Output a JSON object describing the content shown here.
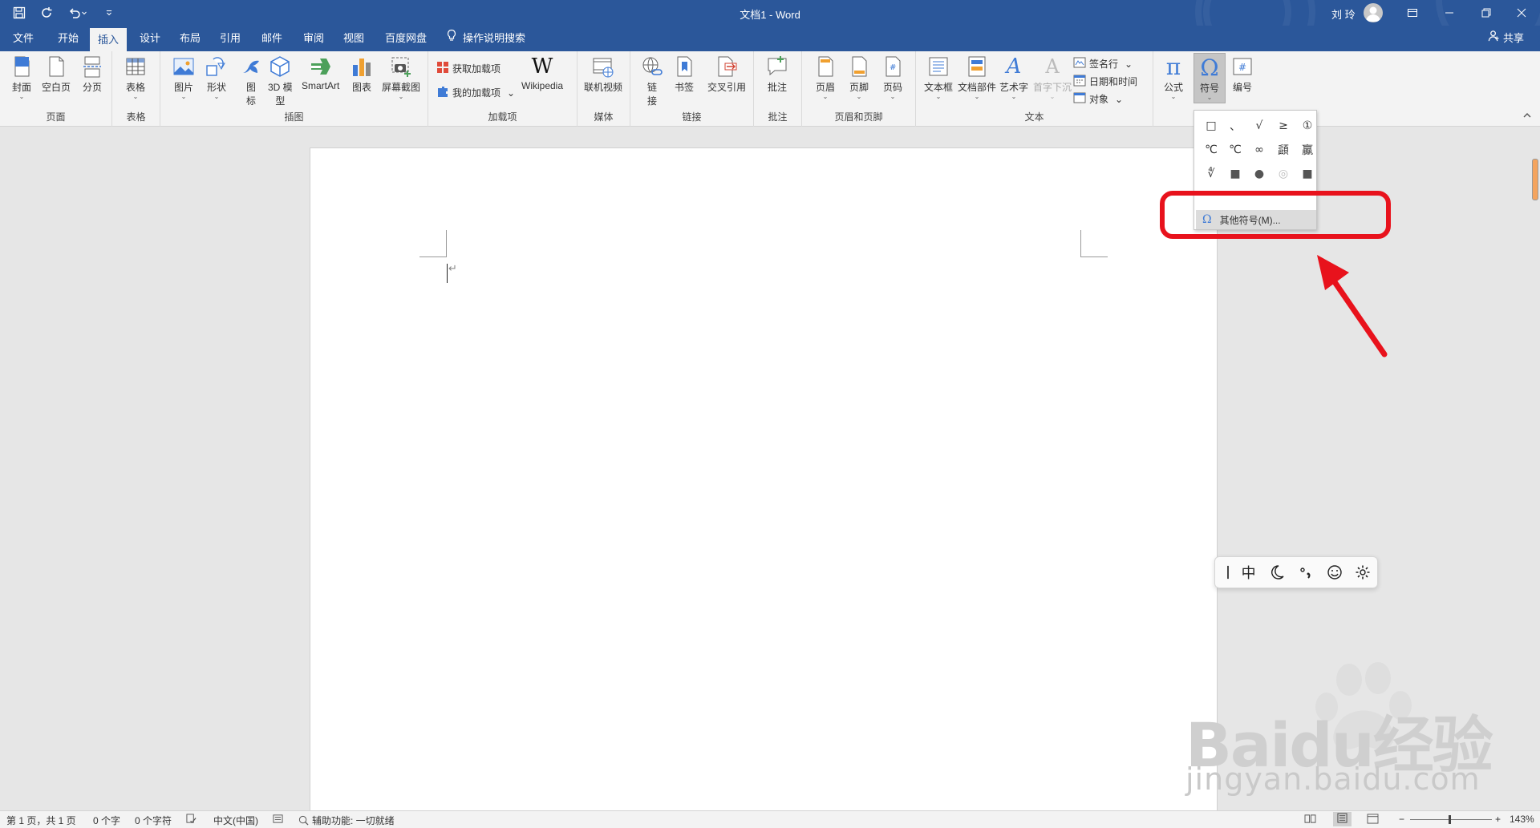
{
  "window": {
    "doc_title": "文档1 - Word",
    "user_name": "刘 玲"
  },
  "tabs": [
    {
      "label": "文件"
    },
    {
      "label": "开始"
    },
    {
      "label": "插入",
      "active": true
    },
    {
      "label": "设计"
    },
    {
      "label": "布局"
    },
    {
      "label": "引用"
    },
    {
      "label": "邮件"
    },
    {
      "label": "审阅"
    },
    {
      "label": "视图"
    },
    {
      "label": "百度网盘"
    }
  ],
  "tell_me": "操作说明搜索",
  "share": "共享",
  "ribbon": {
    "groups": {
      "pages": "页面",
      "tables": "表格",
      "illustrations": "插图",
      "addins": "加载项",
      "media": "媒体",
      "links": "链接",
      "comments": "批注",
      "header_footer": "页眉和页脚",
      "text": "文本"
    },
    "buttons": {
      "cover": "封面",
      "blank_page": "空白页",
      "page_break": "分页",
      "table": "表格",
      "picture": "图片",
      "shapes": "形状",
      "icons_line1": "图",
      "icons_line2": "标",
      "model3d_line1": "3D 模",
      "model3d_line2": "型",
      "smartart": "SmartArt",
      "chart": "图表",
      "screenshot": "屏幕截图",
      "get_addins": "获取加载项",
      "my_addins": "我的加载项",
      "wikipedia": "Wikipedia",
      "online_video": "联机视频",
      "link_line1": "链",
      "link_line2": "接",
      "bookmark": "书签",
      "cross_ref": "交叉引用",
      "comment": "批注",
      "header": "页眉",
      "footer": "页脚",
      "page_number": "页码",
      "text_box": "文本框",
      "quick_parts": "文档部件",
      "wordart": "艺术字",
      "drop_cap": "首字下沉",
      "signature_line": "签名行",
      "date_time": "日期和时间",
      "object": "对象",
      "equation": "公式",
      "symbol": "符号",
      "numbering": "编号"
    }
  },
  "symbol_dropdown": {
    "symbols": [
      "□",
      "、",
      "√",
      "≥",
      "①",
      "℃",
      "℃",
      "∞",
      "頿",
      "鸁",
      "∜",
      "■",
      "●",
      "◎",
      "■"
    ],
    "more_symbols": "其他符号(M)..."
  },
  "ime_toolbar": {
    "mode": "中"
  },
  "statusbar": {
    "page": "第 1 页，共 1 页",
    "words": "0 个字",
    "chars": "0 个字符",
    "language": "中文(中国)",
    "accessibility": "辅助功能: 一切就绪",
    "zoom": "143%"
  },
  "watermark": {
    "brand": "Baidu经验",
    "url": "jingyan.baidu.com"
  },
  "colors": {
    "word_blue": "#2b579a",
    "highlight_red": "#e8121c"
  }
}
